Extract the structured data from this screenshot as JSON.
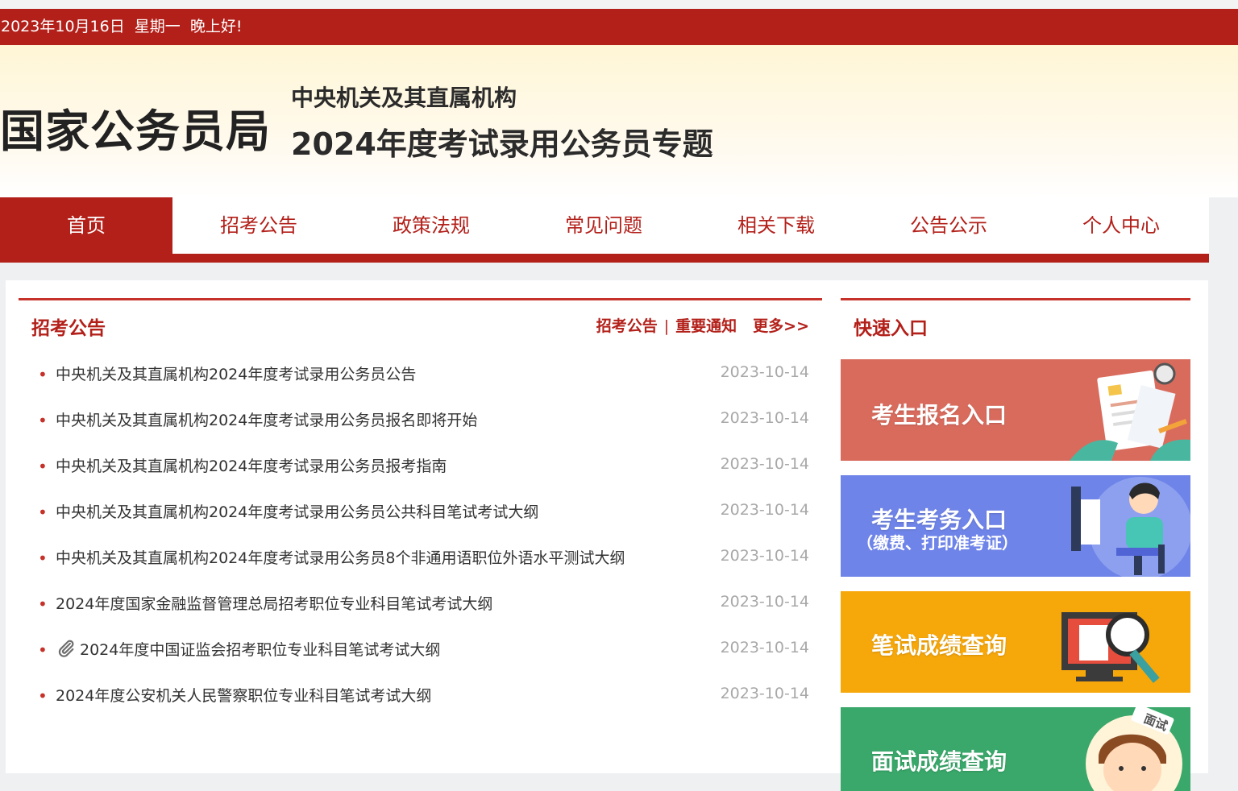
{
  "topbar": {
    "text": "2023年10月16日  星期一  晚上好!"
  },
  "header": {
    "site_name": "国家公务员局",
    "subtitle_line1": "中央机关及其直属机构",
    "subtitle_line2": "2024年度考试录用公务员专题"
  },
  "nav": {
    "items": [
      {
        "label": "首页"
      },
      {
        "label": "招考公告"
      },
      {
        "label": "政策法规"
      },
      {
        "label": "常见问题"
      },
      {
        "label": "相关下载"
      },
      {
        "label": "公告公示"
      },
      {
        "label": "个人中心"
      }
    ]
  },
  "announcements": {
    "title": "招考公告",
    "tab1": "招考公告",
    "sep": "|",
    "tab2": "重要通知",
    "more": "更多>>",
    "items": [
      {
        "title": "中央机关及其直属机构2024年度考试录用公务员公告",
        "date": "2023-10-14"
      },
      {
        "title": "中央机关及其直属机构2024年度考试录用公务员报名即将开始",
        "date": "2023-10-14"
      },
      {
        "title": "中央机关及其直属机构2024年度考试录用公务员报考指南",
        "date": "2023-10-14"
      },
      {
        "title": "中央机关及其直属机构2024年度考试录用公务员公共科目笔试考试大纲",
        "date": "2023-10-14"
      },
      {
        "title": "中央机关及其直属机构2024年度考试录用公务员8个非通用语职位外语水平测试大纲",
        "date": "2023-10-14"
      },
      {
        "title": "2024年度国家金融监督管理总局招考职位专业科目笔试考试大纲",
        "date": "2023-10-14"
      },
      {
        "title": "2024年度中国证监会招考职位专业科目笔试考试大纲",
        "date": "2023-10-14"
      },
      {
        "title": "2024年度公安机关人民警察职位专业科目笔试考试大纲",
        "date": "2023-10-14"
      }
    ]
  },
  "quick": {
    "title": "快速入口",
    "cards": [
      {
        "label": "考生报名入口"
      },
      {
        "label": "考生考务入口",
        "sub": "（缴费、打印准考证）"
      },
      {
        "label": "笔试成绩查询"
      },
      {
        "label": "面试成绩查询",
        "badge": "面试"
      }
    ]
  }
}
